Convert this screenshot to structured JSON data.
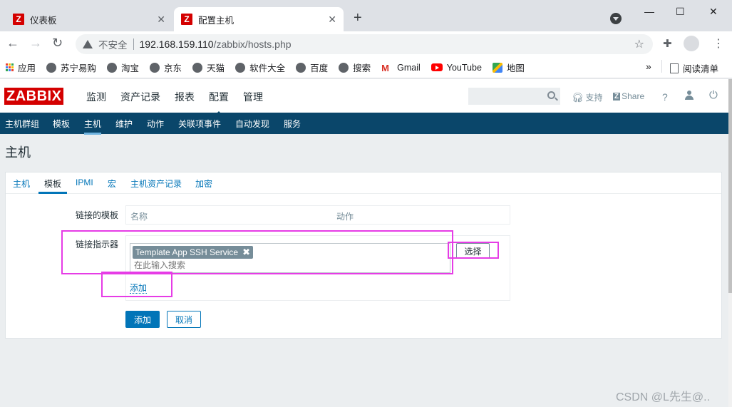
{
  "browser": {
    "tabs": [
      {
        "title": "仪表板",
        "active": false
      },
      {
        "title": "配置主机",
        "active": true
      }
    ],
    "new_tab": "+",
    "window_controls": {
      "minimize": "—",
      "maximize": "☐",
      "close": "✕"
    },
    "insecure_label": "不安全",
    "url_host": "192.168.159.110",
    "url_path": "/zabbix/hosts.php",
    "bookmarks": [
      "应用",
      "苏宁易购",
      "淘宝",
      "京东",
      "天猫",
      "软件大全",
      "百度",
      "搜索",
      "Gmail",
      "YouTube",
      "地图"
    ],
    "bookmarks_more": "»",
    "reading_list": "阅读清单"
  },
  "zabbix": {
    "logo": "ZABBIX",
    "top_menu": [
      "监测",
      "资产记录",
      "报表",
      "配置",
      "管理"
    ],
    "top_menu_selected": "配置",
    "support_label": "支持",
    "share_label": "Share",
    "help_label": "?",
    "sub_menu": [
      "主机群组",
      "模板",
      "主机",
      "维护",
      "动作",
      "关联项事件",
      "自动发现",
      "服务"
    ],
    "sub_menu_selected": "主机",
    "page_title": "主机",
    "form_tabs": [
      "主机",
      "模板",
      "IPMI",
      "宏",
      "主机资产记录",
      "加密"
    ],
    "form_tab_selected": "模板",
    "linked_templates_label": "链接的模板",
    "col_name": "名称",
    "col_action": "动作",
    "link_indicator_label": "链接指示器",
    "selected_template": "Template App SSH Service",
    "search_placeholder": "在此输入搜索",
    "select_button": "选择",
    "add_link": "添加",
    "add_button": "添加",
    "cancel_button": "取消",
    "accent_color": "#0275b8",
    "header_color": "#0a466a",
    "highlight_color": "#e63ce6"
  },
  "watermark": "CSDN @L先生@.."
}
